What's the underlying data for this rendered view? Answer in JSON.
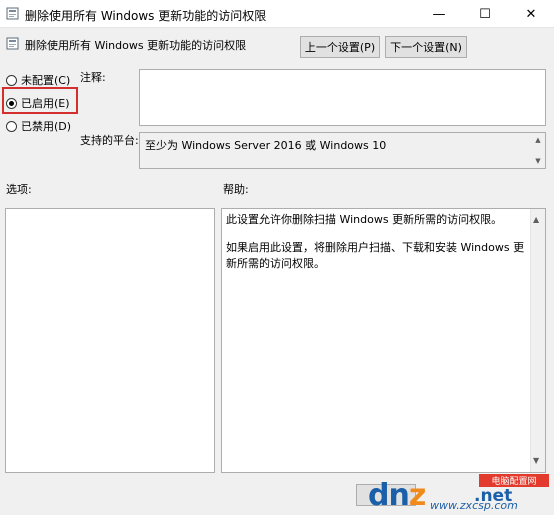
{
  "window": {
    "title": "删除使用所有 Windows 更新功能的访问权限",
    "icon": "policy-icon",
    "controls": {
      "minimize": "—",
      "maximize": "☐",
      "close": "✕"
    }
  },
  "header": {
    "policy_name": "删除使用所有 Windows 更新功能的访问权限",
    "prev_button": "上一个设置(P)",
    "next_button": "下一个设置(N)"
  },
  "state": {
    "options": [
      {
        "label": "未配置(C)",
        "checked": false
      },
      {
        "label": "已启用(E)",
        "checked": true
      },
      {
        "label": "已禁用(D)",
        "checked": false
      }
    ]
  },
  "fields": {
    "comment_label": "注释:",
    "comment_value": "",
    "platform_label": "支持的平台:",
    "platform_value": "至少为 Windows Server 2016 或 Windows 10"
  },
  "panels": {
    "options_label": "选项:",
    "help_label": "帮助:",
    "help_text": [
      "此设置允许你删除扫描 Windows 更新所需的访问权限。",
      "如果启用此设置，将删除用户扫描、下载和安装 Windows 更新所需的访问权限。"
    ]
  },
  "watermark": {
    "logo_text_a": "dn",
    "logo_text_z": "z",
    "logo_tld": ".net",
    "badge": "电脑配置网",
    "url": "www.zxcsp.com"
  },
  "colors": {
    "highlight": "#d32f2f",
    "watermark_blue": "#1b5fa8",
    "watermark_orange": "#f08a1c",
    "watermark_red": "#e23b2e"
  }
}
